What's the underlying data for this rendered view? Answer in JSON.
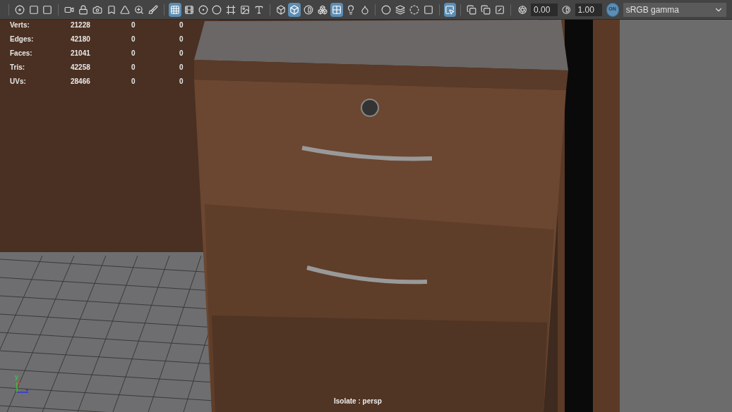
{
  "toolbar": {
    "groups": [
      [
        {
          "selected": false
        },
        {
          "selected": false
        },
        {
          "selected": false
        }
      ],
      [
        {
          "selected": false
        },
        {
          "selected": false
        },
        {
          "selected": false
        },
        {
          "selected": false
        },
        {
          "selected": false
        },
        {
          "selected": false
        },
        {
          "selected": false
        }
      ],
      [
        {
          "selected": true
        },
        {
          "selected": false
        },
        {
          "selected": false
        },
        {
          "selected": false
        },
        {
          "selected": false
        },
        {
          "selected": false
        },
        {
          "selected": false
        }
      ],
      [
        {
          "selected": false
        },
        {
          "selected": true
        },
        {
          "selected": false
        },
        {
          "selected": false
        },
        {
          "selected": true
        },
        {
          "selected": false
        },
        {
          "selected": false
        }
      ],
      [
        {
          "selected": false
        },
        {
          "selected": false
        },
        {
          "selected": false
        },
        {
          "selected": false
        }
      ],
      [
        {
          "selected": true
        }
      ],
      [
        {
          "selected": false
        },
        {
          "selected": false
        },
        {
          "selected": false
        }
      ]
    ],
    "exposure": "0.00",
    "gamma": "1.00",
    "view_transform": {
      "label": "ON",
      "on": true
    },
    "color_space": "sRGB gamma"
  },
  "stats": [
    {
      "label": "Verts:",
      "values": [
        "21228",
        "0",
        "0"
      ]
    },
    {
      "label": "Edges:",
      "values": [
        "42180",
        "0",
        "0"
      ]
    },
    {
      "label": "Faces:",
      "values": [
        "21041",
        "0",
        "0"
      ]
    },
    {
      "label": "Tris:",
      "values": [
        "42258",
        "0",
        "0"
      ]
    },
    {
      "label": "UVs:",
      "values": [
        "28466",
        "0",
        "0"
      ]
    }
  ],
  "axis_labels": [
    "y",
    "z"
  ],
  "isolate_label": "Isolate : persp"
}
